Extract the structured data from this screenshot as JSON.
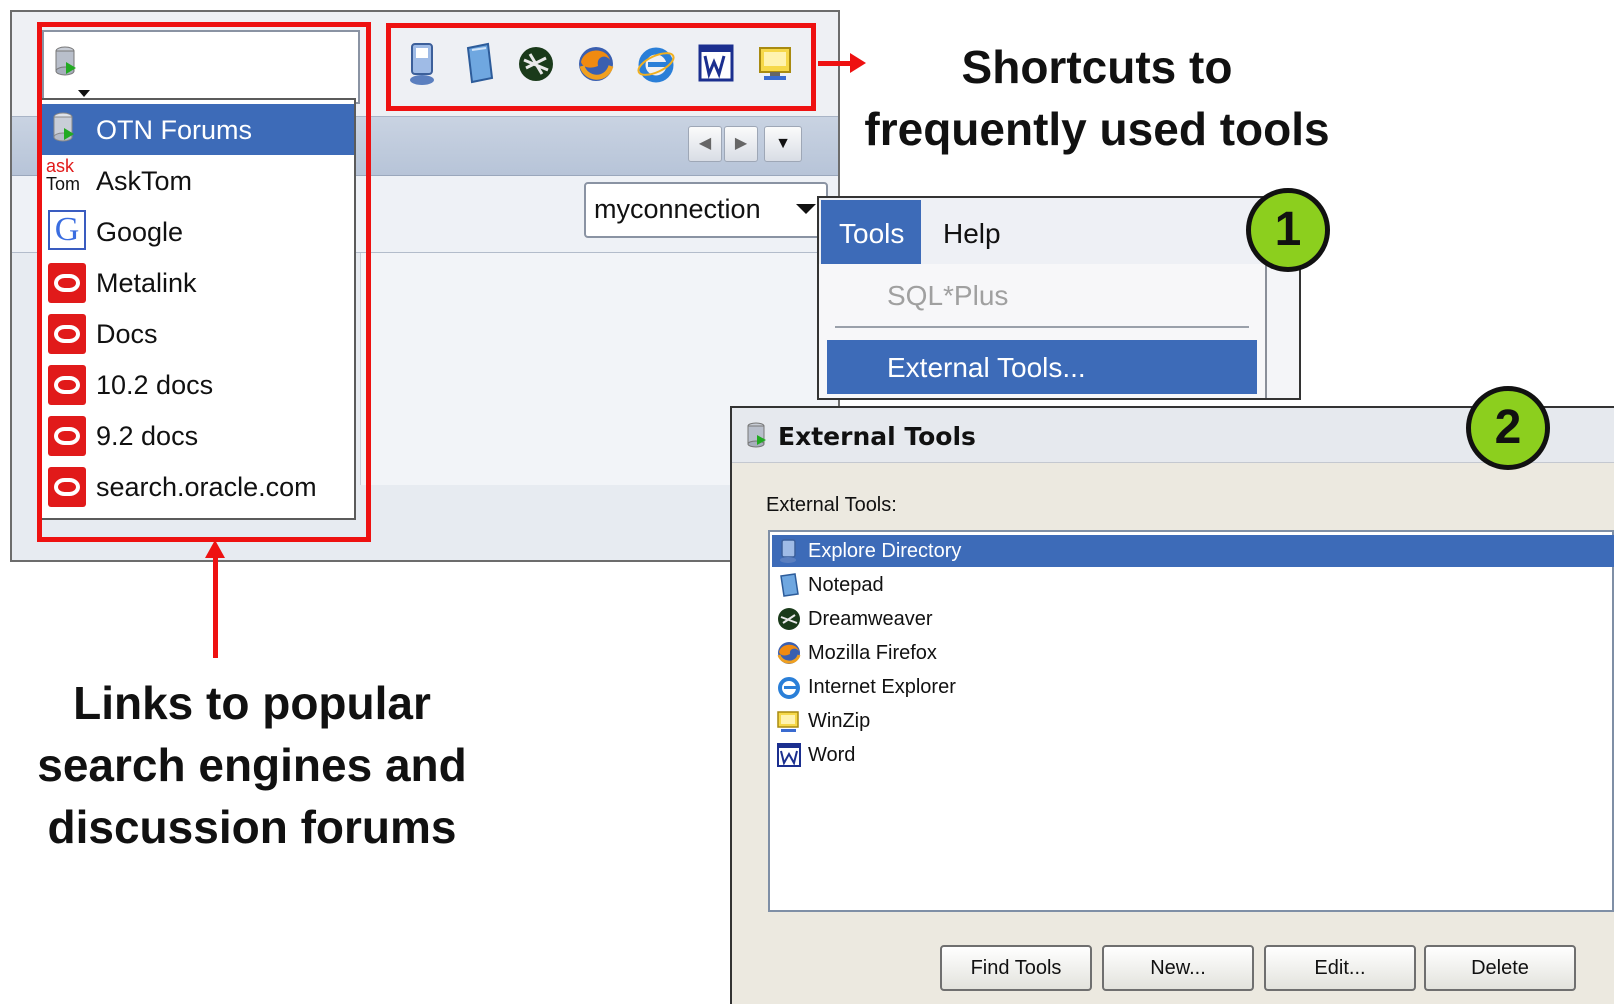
{
  "ide": {
    "connection_combo": "myconnection"
  },
  "link_dropdown": {
    "items": [
      {
        "label": "OTN Forums",
        "icon": "database-icon",
        "selected": true
      },
      {
        "label": "AskTom",
        "icon": "asktom-icon"
      },
      {
        "label": "Google",
        "icon": "google-icon"
      },
      {
        "label": "Metalink",
        "icon": "oracle-icon"
      },
      {
        "label": "Docs",
        "icon": "oracle-icon"
      },
      {
        "label": "10.2 docs",
        "icon": "oracle-icon"
      },
      {
        "label": "9.2 docs",
        "icon": "oracle-icon"
      },
      {
        "label": "search.oracle.com",
        "icon": "oracle-icon"
      }
    ],
    "asktom_icon_text": {
      "top": "ask",
      "bottom": "Tom"
    }
  },
  "shortcut_toolbar": {
    "icons": [
      "explore-directory-icon",
      "notepad-icon",
      "dreamweaver-icon",
      "firefox-icon",
      "internet-explorer-icon",
      "word-icon",
      "winzip-icon"
    ]
  },
  "captions": {
    "shortcuts": [
      "Shortcuts to",
      "frequently used tools"
    ],
    "links": [
      "Links to popular",
      "search engines and",
      "discussion forums"
    ]
  },
  "badges": {
    "one": "1",
    "two": "2"
  },
  "tools_menu": {
    "menubar": [
      "Tools",
      "Help"
    ],
    "items": {
      "sqlplus": "SQL*Plus",
      "external_tools": "External Tools..."
    }
  },
  "external_tools_dialog": {
    "title": "External Tools",
    "list_label": "External Tools:",
    "tools": [
      {
        "label": "Explore Directory",
        "icon": "explore-directory-icon",
        "selected": true
      },
      {
        "label": "Notepad",
        "icon": "notepad-icon"
      },
      {
        "label": "Dreamweaver",
        "icon": "dreamweaver-icon"
      },
      {
        "label": "Mozilla Firefox",
        "icon": "firefox-icon"
      },
      {
        "label": "Internet Explorer",
        "icon": "internet-explorer-icon"
      },
      {
        "label": "WinZip",
        "icon": "winzip-icon"
      },
      {
        "label": "Word",
        "icon": "word-icon"
      }
    ],
    "buttons": {
      "find_tools": "Find Tools",
      "new": "New...",
      "edit": "Edit...",
      "delete": "Delete"
    }
  },
  "colors": {
    "annotation_red": "#ee1111",
    "selection_blue": "#3d6bb8",
    "badge_green": "#8ccf1e",
    "oracle_red": "#e11a1a"
  }
}
